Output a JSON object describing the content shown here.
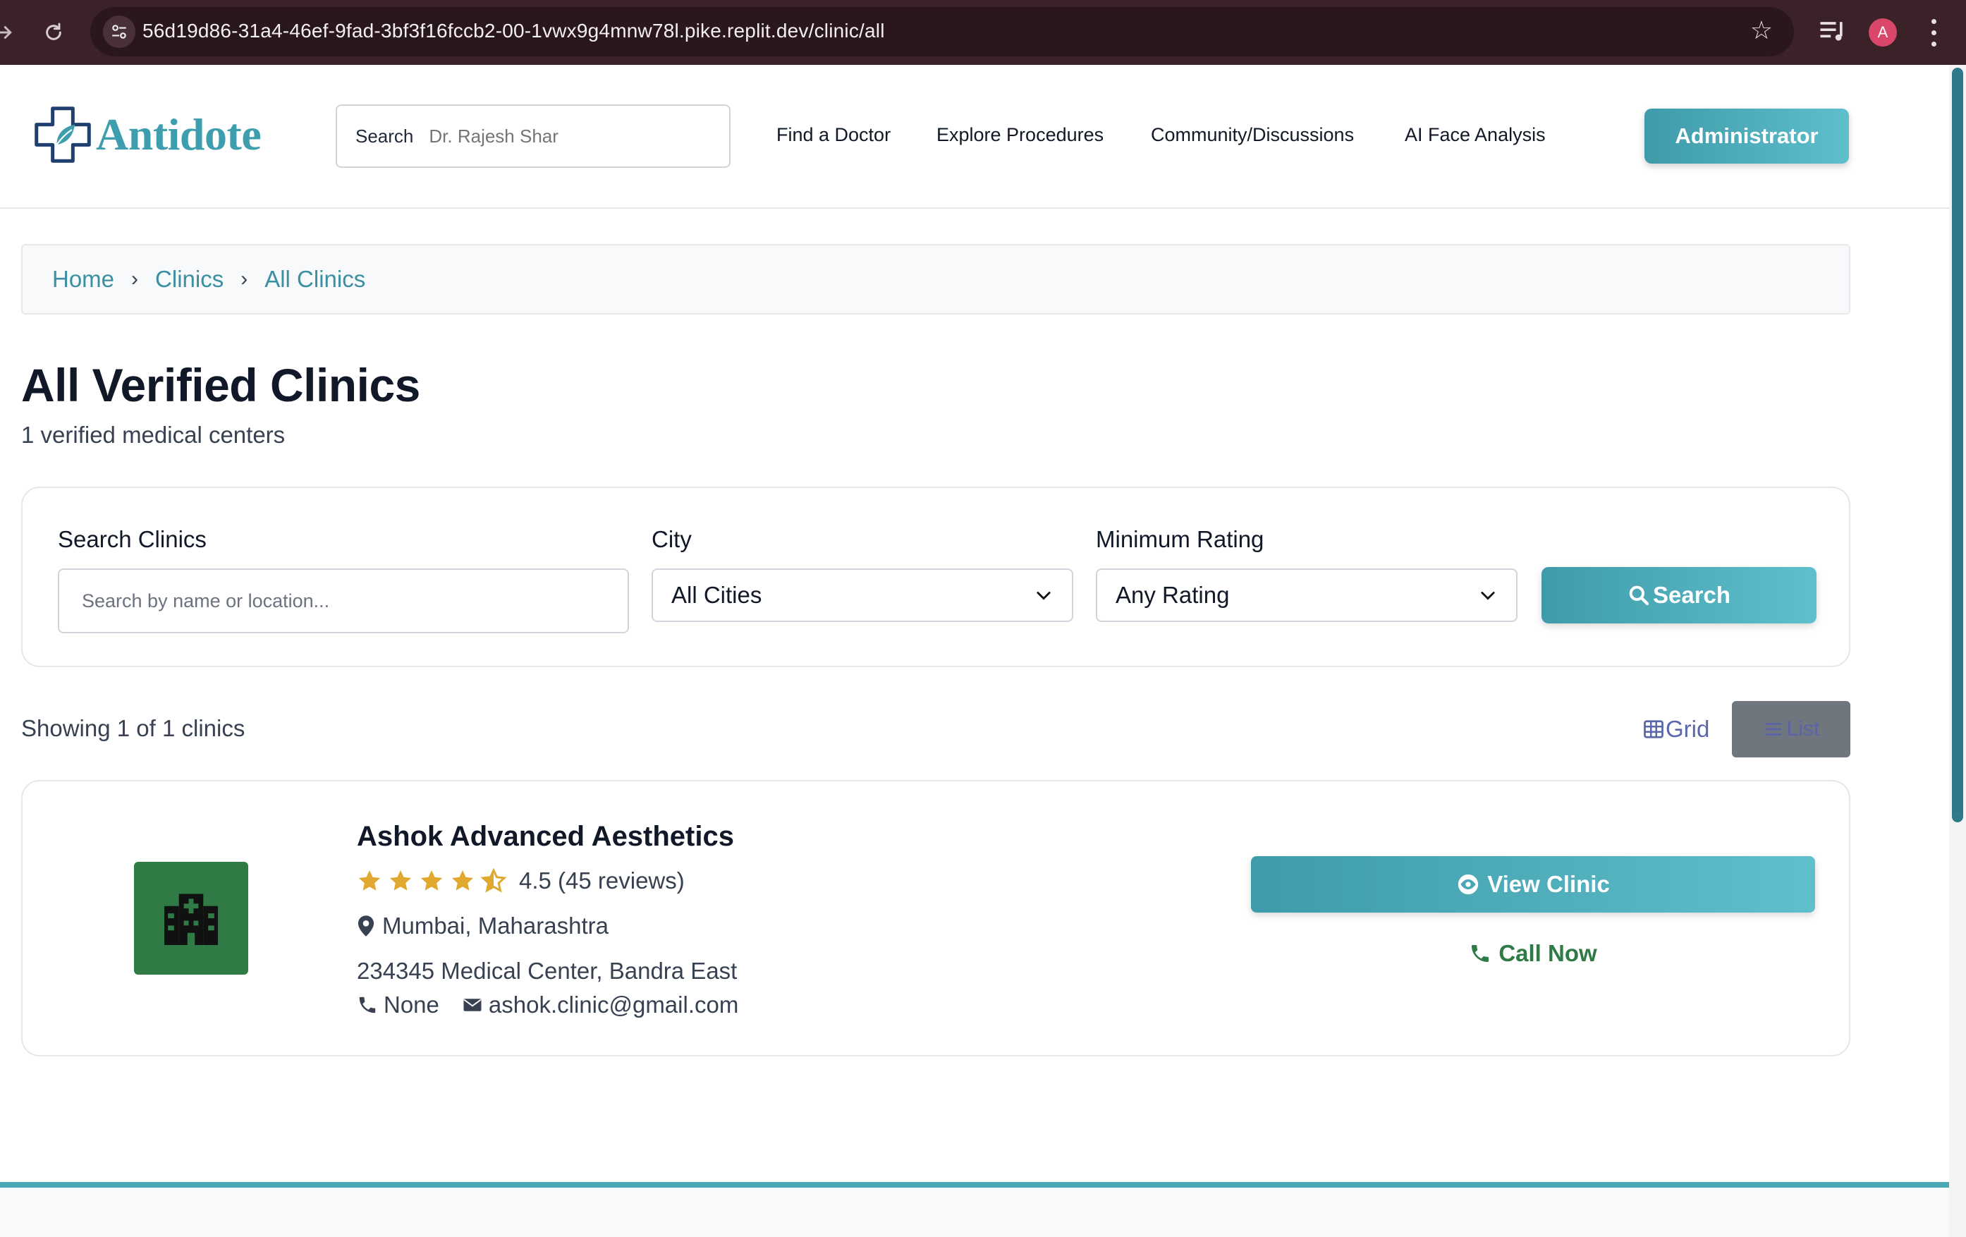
{
  "browser": {
    "url": "56d19d86-31a4-46ef-9fad-3bf3f16fccb2-00-1vwx9g4mnw78l.pike.replit.dev/clinic/all",
    "profile_initial": "A"
  },
  "header": {
    "logo_text": "Antidote",
    "search_label": "Search",
    "search_placeholder": "Dr. Rajesh Shar",
    "nav": [
      "Find a Doctor",
      "Explore Procedures",
      "Community/Discussions",
      "AI Face Analysis"
    ],
    "admin_label": "Administrator"
  },
  "breadcrumb": [
    "Home",
    "Clinics",
    "All Clinics"
  ],
  "page": {
    "title": "All Verified Clinics",
    "subtitle": "1 verified medical centers"
  },
  "filters": {
    "search_label": "Search Clinics",
    "search_placeholder": "Search by name or location...",
    "city_label": "City",
    "city_value": "All Cities",
    "rating_label": "Minimum Rating",
    "rating_value": "Any Rating",
    "search_button": "Search"
  },
  "results": {
    "count_text": "Showing 1 of 1 clinics",
    "grid_label": "Grid",
    "list_label": "List"
  },
  "clinic": {
    "name": "Ashok Advanced Aesthetics",
    "rating": 4.5,
    "rating_text": "4.5 (45 reviews)",
    "city": "Mumbai, Maharashtra",
    "address": "234345 Medical Center, Bandra East",
    "phone": "None",
    "email": "ashok.clinic@gmail.com",
    "view_button": "View Clinic",
    "call_button": "Call Now"
  },
  "colors": {
    "brand": "#3f9ead",
    "clinic_green": "#2f7a45",
    "star": "#e0a82e"
  }
}
